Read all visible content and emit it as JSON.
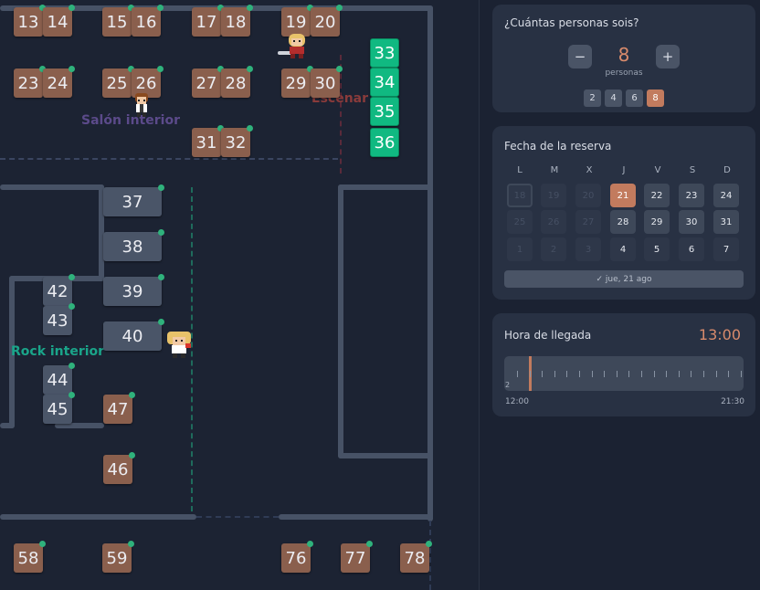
{
  "map": {
    "zones": [
      {
        "name": "salon",
        "label": "Salón interior",
        "color": "#5b4a8a"
      },
      {
        "name": "escenario",
        "label": "Escenar",
        "color": "#8a3b3b"
      },
      {
        "name": "rock",
        "label": "Rock interior",
        "color": "#1aa58a"
      }
    ],
    "tables": [
      "13",
      "14",
      "15",
      "16",
      "17",
      "18",
      "19",
      "20",
      "23",
      "24",
      "25",
      "26",
      "27",
      "28",
      "29",
      "30",
      "31",
      "32",
      "33",
      "34",
      "35",
      "36",
      "37",
      "38",
      "39",
      "40",
      "42",
      "43",
      "44",
      "45",
      "46",
      "47",
      "58",
      "59",
      "76",
      "77",
      "78"
    ]
  },
  "party": {
    "title": "¿Cuántas personas sois?",
    "minus_label": "−",
    "plus_label": "+",
    "count": "8",
    "unit": "personas",
    "quick_options": [
      "2",
      "4",
      "6",
      "8"
    ],
    "selected": "8"
  },
  "date": {
    "title": "Fecha de la reserva",
    "weekdays": [
      "L",
      "M",
      "X",
      "J",
      "V",
      "S",
      "D"
    ],
    "weeks": [
      [
        "18",
        "19",
        "20",
        "21",
        "22",
        "23",
        "24"
      ],
      [
        "25",
        "26",
        "27",
        "28",
        "29",
        "30",
        "31"
      ],
      [
        "1",
        "2",
        "3",
        "4",
        "5",
        "6",
        "7"
      ]
    ],
    "selected_label": "✓ jue, 21 ago"
  },
  "arrival": {
    "title": "Hora de llegada",
    "value": "13:00",
    "mini": "2",
    "range_start": "12:00",
    "range_end": "21:30",
    "position": 0.0526
  },
  "colors": {
    "accent": "#c27b5e",
    "table_reserved": "#8a5f4d",
    "table_free": "#4a5568",
    "table_selected": "#10b981",
    "status_dot": "#2fb27c"
  }
}
